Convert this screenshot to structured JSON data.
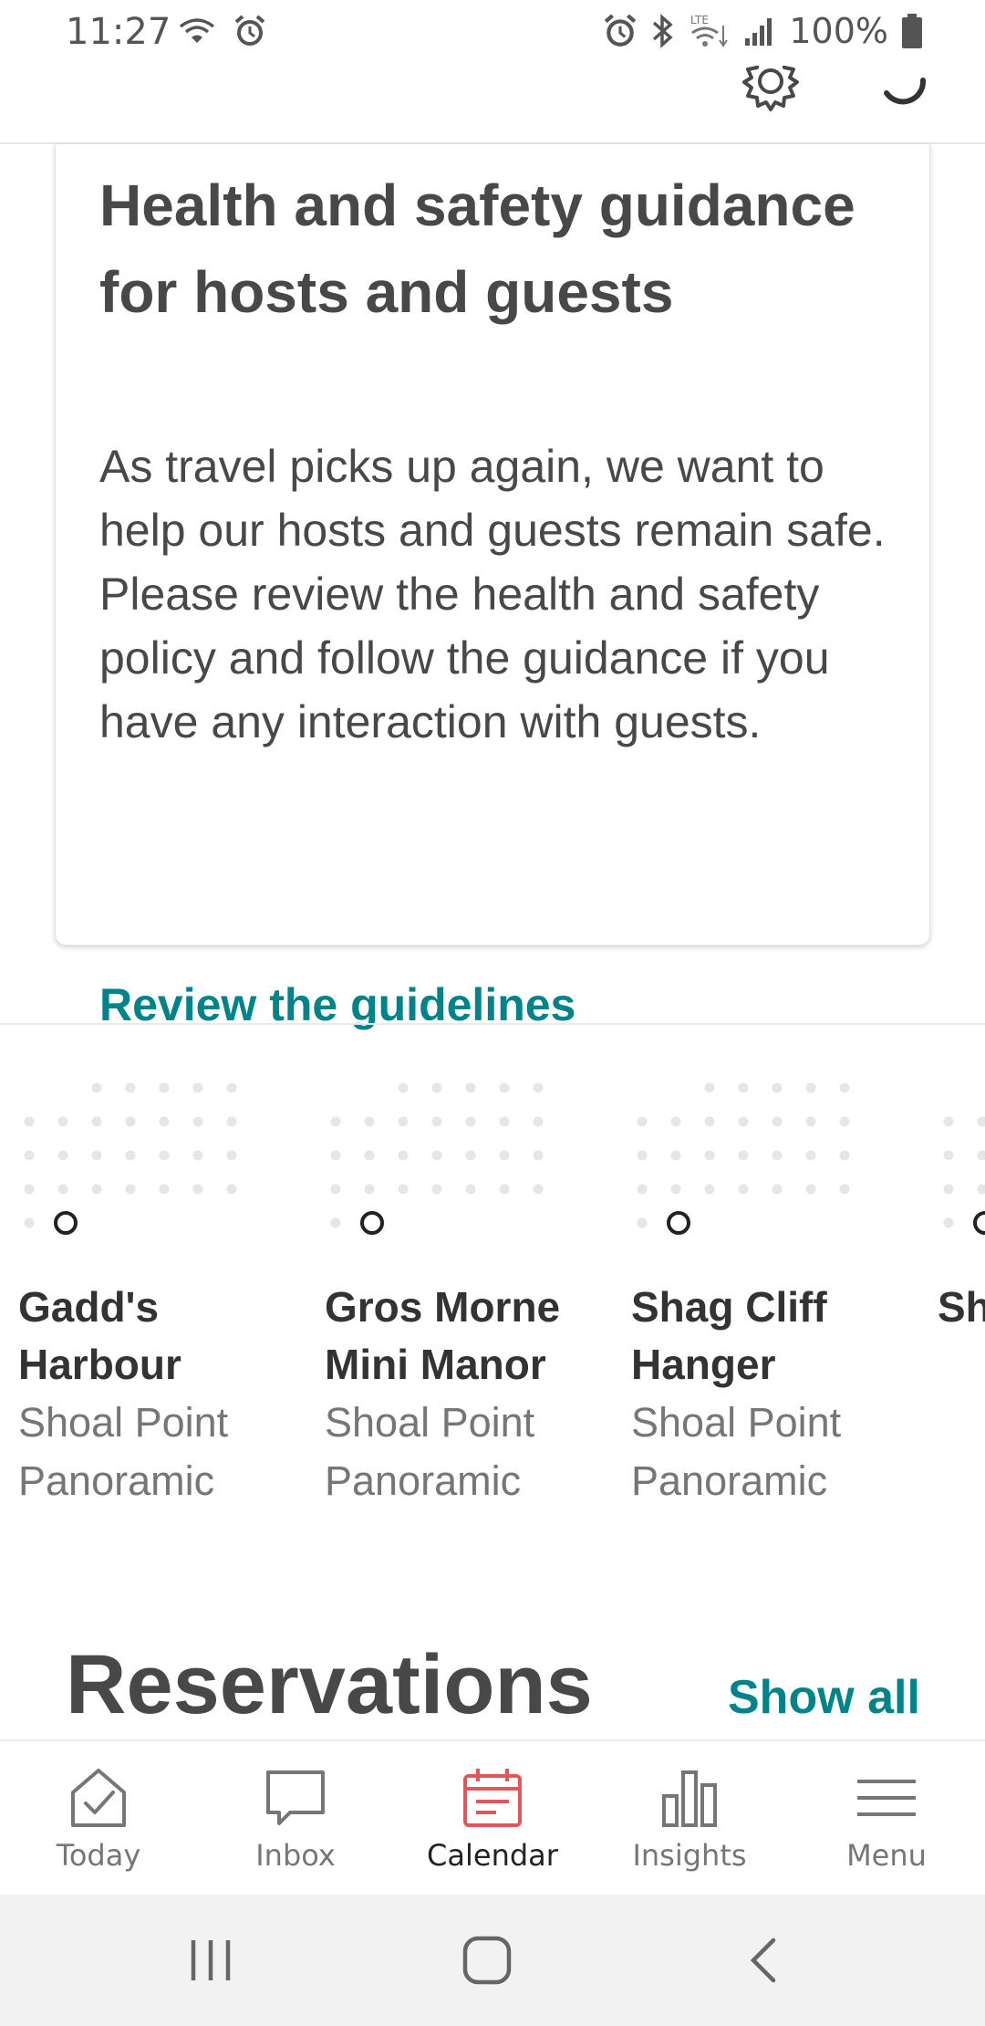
{
  "status_bar": {
    "time": "11:27",
    "battery": "100%"
  },
  "card": {
    "title": "Health and safety guidance for hosts and guests",
    "body": "As travel picks up again, we want to help our hosts and guests remain safe. Please review the health and safety policy and follow the guidance if you have any interaction with guests.",
    "link": "Review the guidelines"
  },
  "listings": [
    {
      "name": "Gadd's Harbour",
      "subtitle": "Shoal Point Panoramic"
    },
    {
      "name": "Gros Morne Mini Manor",
      "subtitle": "Shoal Point Panoramic"
    },
    {
      "name": "Shag Cliff Hanger",
      "subtitle": "Shoal Point Panoramic"
    },
    {
      "name": "Sh Pa",
      "subtitle": ""
    }
  ],
  "reservations": {
    "title": "Reservations",
    "show_all": "Show all"
  },
  "bottom_nav": [
    {
      "label": "Today",
      "icon": "today-check-icon",
      "active": false
    },
    {
      "label": "Inbox",
      "icon": "inbox-chat-icon",
      "active": false
    },
    {
      "label": "Calendar",
      "icon": "calendar-icon",
      "active": true
    },
    {
      "label": "Insights",
      "icon": "insights-bars-icon",
      "active": false
    },
    {
      "label": "Menu",
      "icon": "menu-icon",
      "active": false
    }
  ],
  "colors": {
    "accent": "#008489",
    "active_nav": "#E0565B",
    "text": "#484848",
    "muted": "#767676"
  }
}
